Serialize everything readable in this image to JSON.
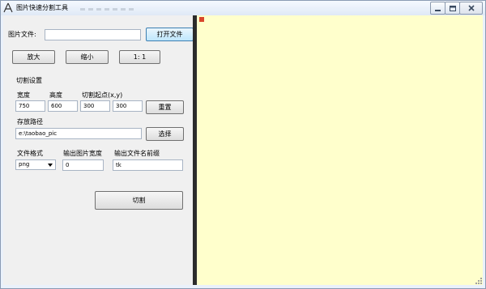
{
  "window": {
    "title": "图片快速分割工具"
  },
  "file": {
    "label": "图片文件:",
    "value": "",
    "open_label": "打开文件"
  },
  "zoom": {
    "in_label": "放大",
    "out_label": "缩小",
    "reset_label": "1: 1"
  },
  "split": {
    "section_label": "切割设置",
    "width_label": "宽度",
    "width_value": "750",
    "height_label": "高度",
    "height_value": "600",
    "origin_label": "切割起点(x,y)",
    "origin_x": "300",
    "origin_y": "300",
    "reset_label": "重置"
  },
  "save": {
    "label": "存放路径",
    "path": "e:\\taobao_pic",
    "browse_label": "选择"
  },
  "output": {
    "format_label": "文件格式",
    "format_value": "png",
    "width_label": "输出图片宽度",
    "width_value": "0",
    "prefix_label": "输出文件名前缀",
    "prefix_value": "tk"
  },
  "cut": {
    "label": "切割"
  },
  "colors": {
    "canvas": "#ffffcc",
    "splitter": "#2b2b2b",
    "panel": "#f0f0f0"
  }
}
